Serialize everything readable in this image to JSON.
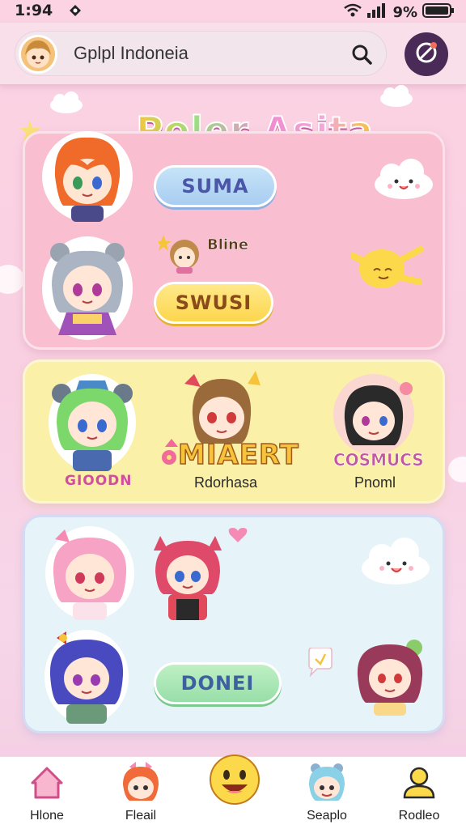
{
  "status_bar": {
    "time": "1:94",
    "battery": "9%"
  },
  "search": {
    "text": "Gplpl Indoneia"
  },
  "title": "Poler Asita",
  "panels": {
    "pink": {
      "button_top": "SUMA",
      "shine_text": "Bline",
      "button_bottom": "SWUSI"
    },
    "yellow": {
      "left_label": "GIOODN",
      "center_big": "MIAERT",
      "center_small": "Rdorhasa",
      "right_big": "COSMUCS",
      "right_small": "Pnoml"
    },
    "blue": {
      "button": "DONEI"
    }
  },
  "bottom_nav": {
    "items": [
      {
        "label": "Hlone"
      },
      {
        "label": "Fleail"
      },
      {
        "label": ""
      },
      {
        "label": "Seaplo"
      },
      {
        "label": "Rodleo"
      }
    ]
  },
  "colors": {
    "accent_pink": "#f9bfd1",
    "accent_yellow": "#fbf0a7",
    "accent_blue": "#e6f3f8",
    "profile_button": "#4a2b57"
  }
}
